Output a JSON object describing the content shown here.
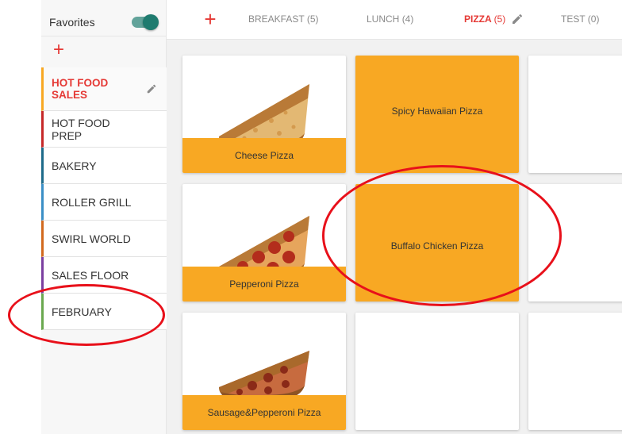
{
  "sidebar": {
    "favorites_label": "Favorites",
    "favorites_on": true,
    "add_icon": "plus-icon",
    "categories": [
      {
        "label": "HOT FOOD SALES",
        "color": "#f8a823",
        "active": true
      },
      {
        "label": "HOT FOOD PREP",
        "color": "#c62828",
        "active": false
      },
      {
        "label": "BAKERY",
        "color": "#1e6b8a",
        "active": false
      },
      {
        "label": "ROLLER GRILL",
        "color": "#3b8fc6",
        "active": false
      },
      {
        "label": "SWIRL WORLD",
        "color": "#d2691e",
        "active": false
      },
      {
        "label": "SALES FLOOR",
        "color": "#7b3fa0",
        "active": false
      },
      {
        "label": "FEBRUARY",
        "color": "#6aa84f",
        "active": false
      }
    ]
  },
  "tabs": {
    "add_icon": "plus-icon",
    "items": [
      {
        "label": "BREAKFAST",
        "count": "(5)",
        "active": false
      },
      {
        "label": "LUNCH",
        "count": "(4)",
        "active": false
      },
      {
        "label": "PIZZA",
        "count": "(5)",
        "active": true
      },
      {
        "label": "TEST",
        "count": "(0)",
        "active": false
      }
    ]
  },
  "grid": {
    "tiles": [
      {
        "label": "Cheese Pizza",
        "kind": "image",
        "pizza": "cheese"
      },
      {
        "label": "Spicy Hawaiian Pizza",
        "kind": "color"
      },
      {
        "label": "",
        "kind": "empty"
      },
      {
        "label": "Pepperoni Pizza",
        "kind": "image",
        "pizza": "pepperoni"
      },
      {
        "label": "Buffalo Chicken Pizza",
        "kind": "color"
      },
      {
        "label": "",
        "kind": "empty"
      },
      {
        "label": "Sausage&Pepperoni Pizza",
        "kind": "image",
        "pizza": "sausage"
      },
      {
        "label": "",
        "kind": "empty"
      },
      {
        "label": "",
        "kind": "empty"
      }
    ]
  },
  "colors": {
    "accent_red": "#e53935",
    "tile_orange": "#f8a823",
    "toggle_teal": "#1f7b6f",
    "annotation_red": "#e8101a"
  }
}
